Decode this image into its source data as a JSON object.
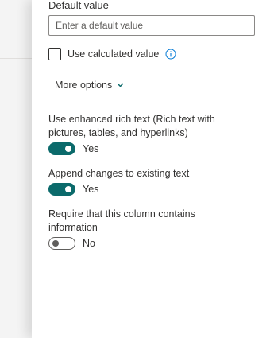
{
  "default_value": {
    "label": "Default value",
    "placeholder": "Enter a default value",
    "value": ""
  },
  "calculated": {
    "label": "Use calculated value",
    "checked": false,
    "info_icon": "info-icon"
  },
  "more_options": {
    "label": "More options",
    "icon": "chevron-down-icon"
  },
  "settings": [
    {
      "label": "Use enhanced rich text (Rich text with pictures, tables, and hyperlinks)",
      "state": "Yes",
      "on": true
    },
    {
      "label": "Append changes to existing text",
      "state": "Yes",
      "on": true
    },
    {
      "label": "Require that this column contains information",
      "state": "No",
      "on": false
    }
  ],
  "colors": {
    "accent": "#0b6a6b",
    "info_icon": "#0078d4"
  }
}
